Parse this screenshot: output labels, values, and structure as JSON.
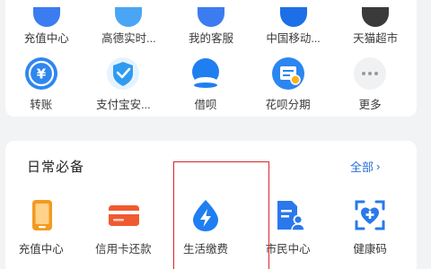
{
  "top_row": {
    "items": [
      {
        "label": "充值中心",
        "peek_color": "#3b7cf0"
      },
      {
        "label": "高德实时...",
        "peek_color": "#4aa6f5"
      },
      {
        "label": "我的客服",
        "peek_color": "#3b7cf0"
      },
      {
        "label": "中国移动...",
        "peek_color": "#1d6fe8"
      },
      {
        "label": "天猫超市",
        "peek_color": "#3a3a3a"
      }
    ]
  },
  "services": {
    "items": [
      {
        "label": "转账",
        "icon": "transfer-icon"
      },
      {
        "label": "支付宝安...",
        "icon": "shield-icon"
      },
      {
        "label": "借呗",
        "icon": "jiebei-icon"
      },
      {
        "label": "花呗分期",
        "icon": "huabei-icon"
      },
      {
        "label": "更多",
        "icon": "more-icon"
      }
    ]
  },
  "daily": {
    "title": "日常必备",
    "see_all_label": "全部",
    "items": [
      {
        "label": "充值中心",
        "icon": "phone-icon"
      },
      {
        "label": "信用卡还款",
        "icon": "credit-card-icon"
      },
      {
        "label": "生活缴费",
        "icon": "lightning-icon"
      },
      {
        "label": "市民中心",
        "icon": "citizen-icon"
      },
      {
        "label": "健康码",
        "icon": "health-code-icon"
      }
    ]
  },
  "colors": {
    "accent_blue": "#2a6fd6",
    "highlight_red": "#d5272b",
    "orange": "#f39a1f",
    "red_orange": "#f05a30"
  }
}
